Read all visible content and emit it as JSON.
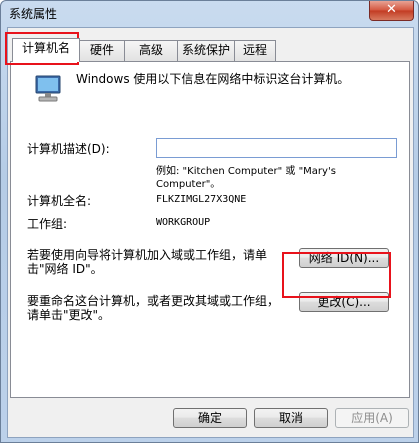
{
  "window": {
    "title": "系统属性",
    "close_label": "✕"
  },
  "tabs": [
    {
      "label": "计算机名",
      "active": true
    },
    {
      "label": "硬件"
    },
    {
      "label": "高级"
    },
    {
      "label": "系统保护"
    },
    {
      "label": "远程"
    }
  ],
  "panel": {
    "info": "Windows 使用以下信息在网络中标识这台计算机。",
    "description_label": "计算机描述(D):",
    "description_value": "",
    "example_line1": "例如: \"Kitchen Computer\" 或 \"Mary's",
    "example_line2": "Computer\"。",
    "fullname_label": "计算机全名:",
    "fullname_value": "FLKZIMGL27X3QNE",
    "workgroup_label": "工作组:",
    "workgroup_value": "WORKGROUP",
    "network_text_line1": "若要使用向导将计算机加入域或工作组，请单",
    "network_text_line2": "击\"网络 ID\"。",
    "network_id_button": "网络 ID(N)...",
    "rename_text_line1": "要重命名这台计算机，或者更改其域或工作组，",
    "rename_text_line2": "请单击\"更改\"。",
    "change_button": "更改(C)..."
  },
  "footer": {
    "ok": "确定",
    "cancel": "取消",
    "apply": "应用(A)"
  },
  "colors": {
    "highlight": "#e8121b"
  }
}
